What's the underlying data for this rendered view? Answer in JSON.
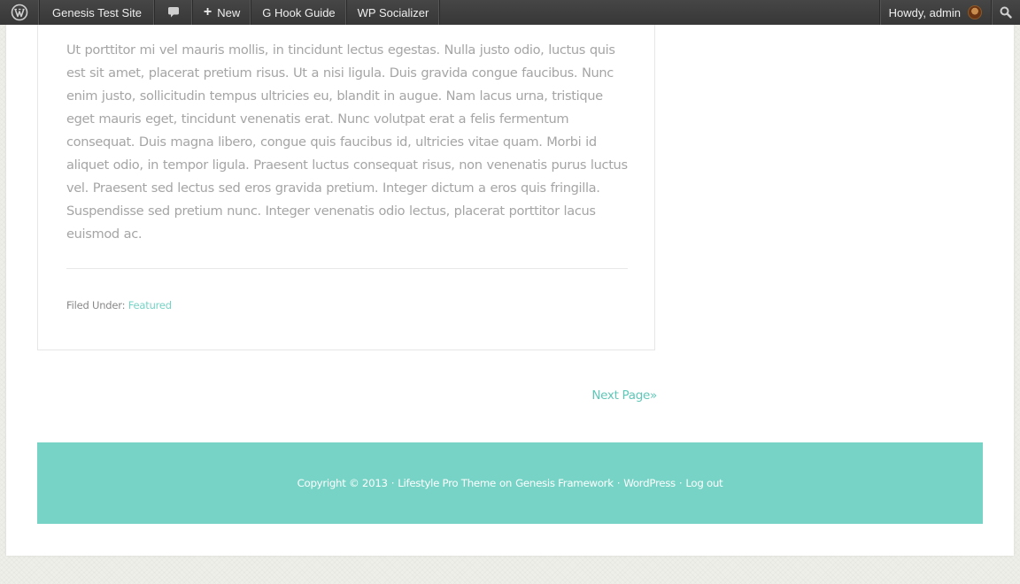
{
  "admin_bar": {
    "site_name": "Genesis Test Site",
    "new_label": "New",
    "new_plus": "+",
    "hook_guide": "G Hook Guide",
    "socializer": "WP Socializer",
    "greeting": "Howdy, admin"
  },
  "post": {
    "body": "Ut porttitor mi vel mauris mollis, in tincidunt lectus egestas. Nulla justo odio, luctus quis est sit amet, placerat pretium risus. Ut a nisi ligula. Duis gravida congue faucibus. Nunc enim justo, sollicitudin tempus ultricies eu, blandit in augue. Nam lacus urna, tristique eget mauris eget, tincidunt venenatis erat. Nunc volutpat erat a felis fermentum consequat. Duis magna libero, congue quis faucibus id, ultricies vitae quam. Morbi id aliquet odio, in tempor ligula. Praesent luctus consequat risus, non venenatis purus luctus vel. Praesent sed lectus sed eros gravida pretium. Integer dictum a eros quis fringilla. Suspendisse sed pretium nunc. Integer venenatis odio lectus, placerat porttitor lacus euismod ac.",
    "filed_under_label": "Filed Under:",
    "category": "Featured"
  },
  "pagination": {
    "next_label": "Next Page»"
  },
  "footer": {
    "copyright": "Copyright © 2013",
    "separator": "·",
    "theme_link": "Lifestyle Pro Theme",
    "on_text": "on",
    "framework_link": "Genesis Framework",
    "wordpress_link": "WordPress",
    "logout_link": "Log out"
  },
  "colors": {
    "accent": "#76d3c5",
    "admin_bar": "#3d3d3d",
    "body_text": "#a5a5a5"
  },
  "icons": {
    "wp_logo": "wordpress-logo-icon",
    "comments": "comment-bubble-icon",
    "search": "search-icon"
  }
}
